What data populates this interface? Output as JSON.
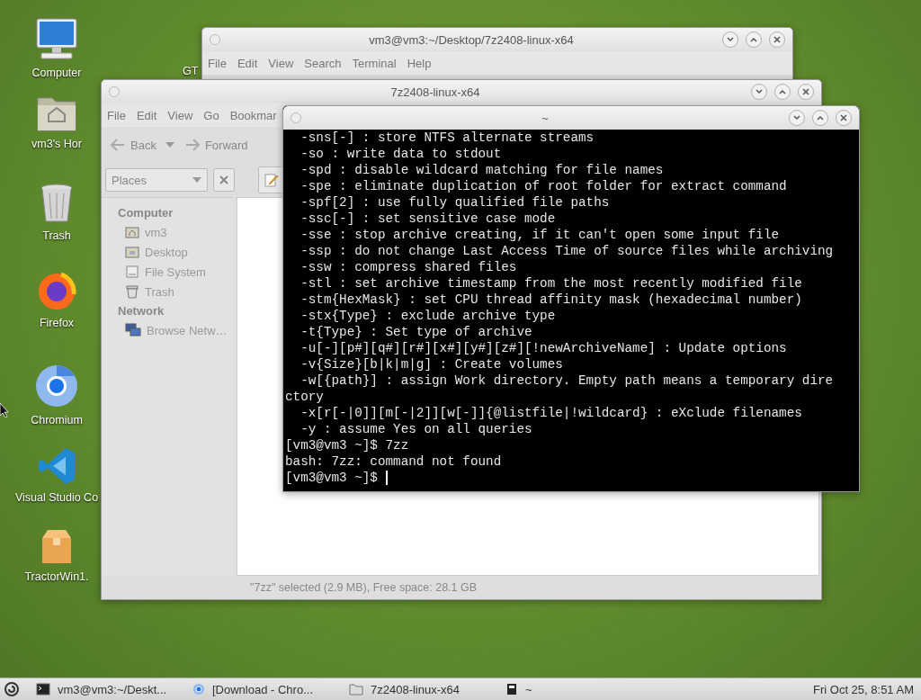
{
  "desktop_icons": [
    {
      "kind": "computer",
      "label": "Computer"
    },
    {
      "kind": "home",
      "label": "vm3's Hor"
    },
    {
      "kind": "trash",
      "label": "Trash"
    },
    {
      "kind": "firefox",
      "label": "Firefox"
    },
    {
      "kind": "chromium",
      "label": "Chromium"
    },
    {
      "kind": "vscode",
      "label": "Visual Studio Co"
    },
    {
      "kind": "package",
      "label": "TractorWin1."
    }
  ],
  "desktop_label_fragment": "GT",
  "back_terminal": {
    "title": "vm3@vm3:~/Desktop/7z2408-linux-x64",
    "menu": [
      "File",
      "Edit",
      "View",
      "Search",
      "Terminal",
      "Help"
    ]
  },
  "file_manager": {
    "title": "7z2408-linux-x64",
    "menu": [
      "File",
      "Edit",
      "View",
      "Go",
      "Bookmar"
    ],
    "back_label": "Back",
    "forward_label": "Forward",
    "places_label": "Places",
    "sidebar": [
      {
        "heading": "Computer",
        "items": [
          {
            "kind": "home",
            "label": "vm3"
          },
          {
            "kind": "desktop",
            "label": "Desktop"
          },
          {
            "kind": "drive",
            "label": "File System"
          },
          {
            "kind": "trash",
            "label": "Trash"
          }
        ]
      },
      {
        "heading": "Network",
        "items": [
          {
            "kind": "network",
            "label": "Browse Netw…"
          }
        ]
      }
    ],
    "status": "\"7zz\" selected (2.9 MB), Free space: 28.1 GB"
  },
  "terminal": {
    "title": "~",
    "lines": [
      "  -sns[-] : store NTFS alternate streams",
      "  -so : write data to stdout",
      "  -spd : disable wildcard matching for file names",
      "  -spe : eliminate duplication of root folder for extract command",
      "  -spf[2] : use fully qualified file paths",
      "  -ssc[-] : set sensitive case mode",
      "  -sse : stop archive creating, if it can't open some input file",
      "  -ssp : do not change Last Access Time of source files while archiving",
      "  -ssw : compress shared files",
      "  -stl : set archive timestamp from the most recently modified file",
      "  -stm{HexMask} : set CPU thread affinity mask (hexadecimal number)",
      "  -stx{Type} : exclude archive type",
      "  -t{Type} : Set type of archive",
      "  -u[-][p#][q#][r#][x#][y#][z#][!newArchiveName] : Update options",
      "  -v{Size}[b|k|m|g] : Create volumes",
      "  -w[{path}] : assign Work directory. Empty path means a temporary dire",
      "ctory",
      "  -x[r[-|0]][m[-|2]][w[-]]{@listfile|!wildcard} : eXclude filenames",
      "  -y : assume Yes on all queries",
      "[vm3@vm3 ~]$ 7zz",
      "bash: 7zz: command not found"
    ],
    "prompt": "[vm3@vm3 ~]$ "
  },
  "taskbar": {
    "items": [
      {
        "kind": "terminal",
        "label": "vm3@vm3:~/Deskt..."
      },
      {
        "kind": "chromium",
        "label": "[Download - Chro..."
      },
      {
        "kind": "folder",
        "label": "7z2408-linux-x64"
      },
      {
        "kind": "app",
        "label": "~"
      }
    ],
    "clock": "Fri Oct 25, 8:51 AM"
  }
}
